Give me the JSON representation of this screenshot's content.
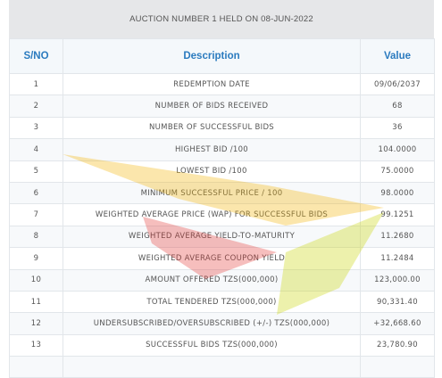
{
  "header": {
    "title": "AUCTION NUMBER 1 HELD ON 08-JUN-2022"
  },
  "columns": {
    "sno": "S/NO",
    "description": "Description",
    "value": "Value"
  },
  "rows": [
    {
      "sno": "1",
      "description": "REDEMPTION DATE",
      "value": "09/06/2037"
    },
    {
      "sno": "2",
      "description": "NUMBER OF BIDS RECEIVED",
      "value": "68"
    },
    {
      "sno": "3",
      "description": "NUMBER OF SUCCESSFUL BIDS",
      "value": "36"
    },
    {
      "sno": "4",
      "description": "HIGHEST BID /100",
      "value": "104.0000"
    },
    {
      "sno": "5",
      "description": "LOWEST BID /100",
      "value": "75.0000"
    },
    {
      "sno": "6",
      "description": "MINIMUM SUCCESSFUL PRICE / 100",
      "value": "98.0000"
    },
    {
      "sno": "7",
      "description": "WEIGHTED AVERAGE PRICE (WAP) FOR SUCCESSFUL BIDS",
      "value": "99.1251"
    },
    {
      "sno": "8",
      "description": "WEIGHTED AVERAGE YIELD-TO-MATURITY",
      "value": "11.2680"
    },
    {
      "sno": "9",
      "description": "WEIGHTED AVERAGE COUPON YIELD",
      "value": "11.2484"
    },
    {
      "sno": "10",
      "description": "AMOUNT OFFERED TZS(000,000)",
      "value": "123,000.00"
    },
    {
      "sno": "11",
      "description": "TOTAL TENDERED TZS(000,000)",
      "value": "90,331.40"
    },
    {
      "sno": "12",
      "description": "UNDERSUBSCRIBED/OVERSUBSCRIBED (+/-) TZS(000,000)",
      "value": "+32,668.60"
    },
    {
      "sno": "13",
      "description": "SUCCESSFUL BIDS TZS(000,000)",
      "value": "23,780.90"
    }
  ],
  "watermark": {
    "colors": [
      "#f4b400",
      "#e53935",
      "#c8d400"
    ]
  }
}
